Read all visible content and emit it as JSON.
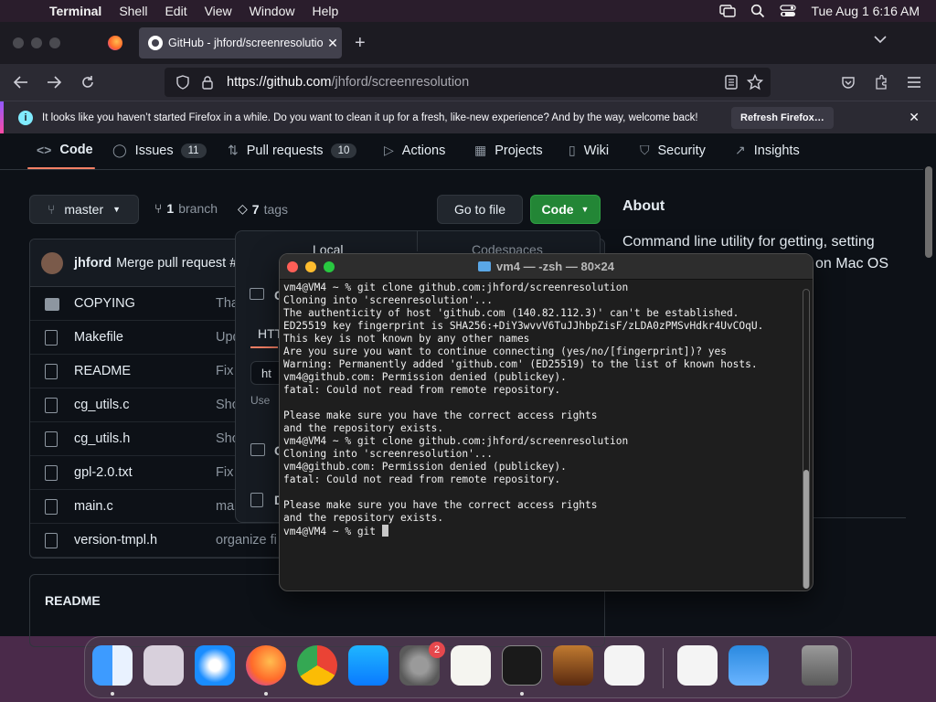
{
  "menubar": {
    "apple": "",
    "app": "Terminal",
    "items": [
      "Shell",
      "Edit",
      "View",
      "Window",
      "Help"
    ],
    "clock": "Tue Aug 1  6:16 AM"
  },
  "firefox": {
    "tab_title": "GitHub - jhford/screenresolution",
    "tab_close": "✕",
    "new_tab": "+",
    "url_host": "https://github.com",
    "url_path": "/jhford/screenresolution",
    "notification_text": "It looks like you haven’t started Firefox in a while. Do you want to clean it up for a fresh, like-new experience? And by the way, welcome back!",
    "notification_button": "Refresh Firefox…",
    "notification_close": "✕"
  },
  "github": {
    "tabs": [
      {
        "label": "Code"
      },
      {
        "label": "Issues",
        "count": "11"
      },
      {
        "label": "Pull requests",
        "count": "10"
      },
      {
        "label": "Actions"
      },
      {
        "label": "Projects"
      },
      {
        "label": "Wiki"
      },
      {
        "label": "Security"
      },
      {
        "label": "Insights"
      }
    ],
    "branch_button": "master",
    "branch_count": "1",
    "branch_label": "branch",
    "tags_count": "7",
    "tags_label": "tags",
    "go_to_file": "Go to file",
    "code_button": "Code",
    "commit_author": "jhford",
    "commit_message": "Merge pull request #",
    "files": [
      {
        "name": "COPYING",
        "msg": "Tha",
        "dir": true
      },
      {
        "name": "Makefile",
        "msg": "Upd"
      },
      {
        "name": "README",
        "msg": "Fix"
      },
      {
        "name": "cg_utils.c",
        "msg": "Sho"
      },
      {
        "name": "cg_utils.h",
        "msg": "Sho"
      },
      {
        "name": "gpl-2.0.txt",
        "msg": "Fix"
      },
      {
        "name": "main.c",
        "msg": "ma"
      },
      {
        "name": "version-tmpl.h",
        "msg": "organize fi"
      }
    ],
    "readme_title": "README",
    "about_title": "About",
    "about_desc": "Command line utility for getting, setting",
    "about_desc_tail": "on Mac OS",
    "dropdown": {
      "tab_local": "Local",
      "tab_codespaces": "Codespaces",
      "https": "HTT",
      "url_fragment": "ht",
      "use_fragment": "Use",
      "item_c": "C",
      "item_d": "D"
    }
  },
  "terminal": {
    "title": "vm4 — -zsh — 80×24",
    "lines": [
      "vm4@VM4 ~ % git clone github.com:jhford/screenresolution",
      "Cloning into 'screenresolution'...",
      "The authenticity of host 'github.com (140.82.112.3)' can't be established.",
      "ED25519 key fingerprint is SHA256:+DiY3wvvV6TuJJhbpZisF/zLDA0zPMSvHdkr4UvCOqU.",
      "This key is not known by any other names",
      "Are you sure you want to continue connecting (yes/no/[fingerprint])? yes",
      "Warning: Permanently added 'github.com' (ED25519) to the list of known hosts.",
      "vm4@github.com: Permission denied (publickey).",
      "fatal: Could not read from remote repository.",
      "",
      "Please make sure you have the correct access rights",
      "and the repository exists.",
      "vm4@VM4 ~ % git clone github.com:jhford/screenresolution",
      "Cloning into 'screenresolution'...",
      "vm4@github.com: Permission denied (publickey).",
      "fatal: Could not read from remote repository.",
      "",
      "Please make sure you have the correct access rights",
      "and the repository exists."
    ],
    "prompt": "vm4@VM4 ~ % git "
  },
  "dock": {
    "apps": [
      "Finder",
      "Launchpad",
      "Safari",
      "Firefox",
      "Chrome",
      "App Store",
      "System Settings",
      "TextEdit",
      "Terminal",
      "GarageBand",
      "Visual Studio Code",
      "Visual Studio",
      "Weather",
      "Trash"
    ],
    "settings_badge": "2"
  },
  "colors": {
    "github_bg": "#0d1117",
    "code_button": "#238636",
    "terminal_bg": "#1e1e1e",
    "tab_underline": "#f78166"
  }
}
